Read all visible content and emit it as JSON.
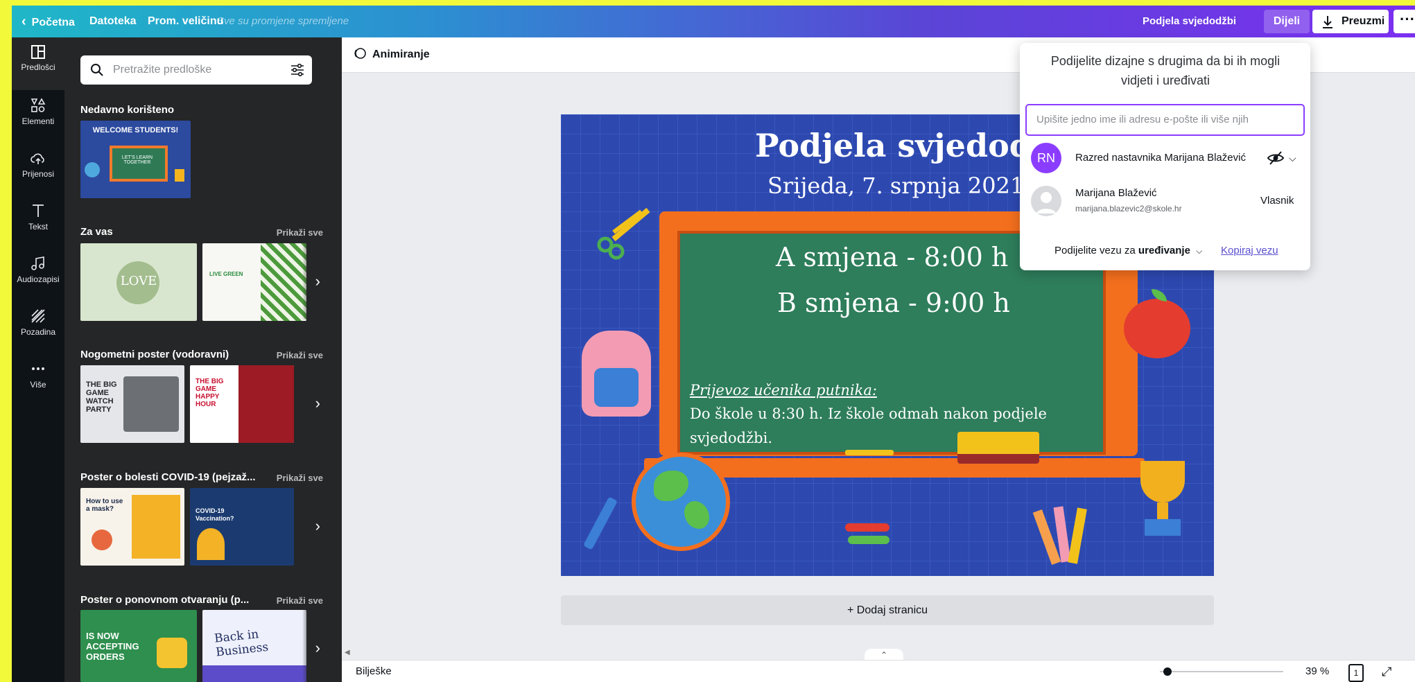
{
  "topbar": {
    "home": "Početna",
    "file": "Datoteka",
    "resize": "Prom. veličinu",
    "saved_status": "Sve su promjene spremljene",
    "doc_title": "Podjela svjedodžbi",
    "share": "Dijeli",
    "download": "Preuzmi",
    "more": "···"
  },
  "rail": [
    {
      "label": "Predlošci",
      "icon": "template-icon"
    },
    {
      "label": "Elementi",
      "icon": "shapes-icon"
    },
    {
      "label": "Prijenosi",
      "icon": "upload-cloud-icon"
    },
    {
      "label": "Tekst",
      "icon": "text-icon"
    },
    {
      "label": "Audiozapisi",
      "icon": "music-note-icon"
    },
    {
      "label": "Pozadina",
      "icon": "background-pattern-icon"
    },
    {
      "label": "Više",
      "icon": "more-dots-icon"
    }
  ],
  "panel": {
    "search_placeholder": "Pretražite predloške",
    "see_all": "Prikaži sve",
    "sections": [
      {
        "title": "Nedavno korišteno",
        "thumbs": [
          "WELCOME STUDENTS!",
          "LET'S LEARN TOGETHER"
        ]
      },
      {
        "title": "Za vas",
        "thumbs": [
          "LOVE",
          "LIVE GREEN"
        ]
      },
      {
        "title": "Nogometni poster (vodoravni)",
        "thumbs": [
          "THE BIG GAME WATCH PARTY",
          "THE BIG GAME HAPPY HOUR"
        ]
      },
      {
        "title": "Poster o bolesti COVID-19 (pejzaž...",
        "thumbs": [
          "How to use a mask?",
          "COVID-19 Vaccination?"
        ]
      },
      {
        "title": "Poster o ponovnom otvaranju (p...",
        "thumbs": [
          "IS NOW ACCEPTING ORDERS",
          "Back in Business"
        ]
      }
    ]
  },
  "editor": {
    "animate": "Animiranje",
    "add_page": "+ Dodaj stranicu",
    "notes": "Bilješke",
    "zoom": "39 %",
    "page_num": "1"
  },
  "design": {
    "title": "Podjela svjedodžbi",
    "date": "Srijeda, 7. srpnja 2021.",
    "shift_a": "A smjena - 8:00 h",
    "shift_b": "B smjena - 9:00 h",
    "transport_heading": "Prijevoz učenika putnika:",
    "transport_line1": "Do škole u 8:30 h. Iz škole odmah nakon podjele",
    "transport_line2": "svjedodžbi."
  },
  "share_popup": {
    "title": "Podijelite dizajne s drugima da bi ih mogli vidjeti i uređivati",
    "input_placeholder": "Upišite jedno ime ili adresu e-pošte ili više njih",
    "team_initials": "RN",
    "team_name": "Razred nastavnika Marijana Blažević",
    "owner_name": "Marijana Blažević",
    "owner_email": "marijana.blazevic2@skole.hr",
    "owner_role": "Vlasnik",
    "link_prefix": "Podijelite vezu za",
    "link_mode": "uređivanje",
    "copy_link": "Kopiraj vezu"
  },
  "colors": {
    "accent": "#8b3dff",
    "rail_bg": "#0e1318",
    "panel_bg": "#252627",
    "canvas_bg": "#2d49b0",
    "board_green": "#2e7d5b",
    "board_frame": "#f36f1e",
    "page_bg": "#f2f93a"
  }
}
